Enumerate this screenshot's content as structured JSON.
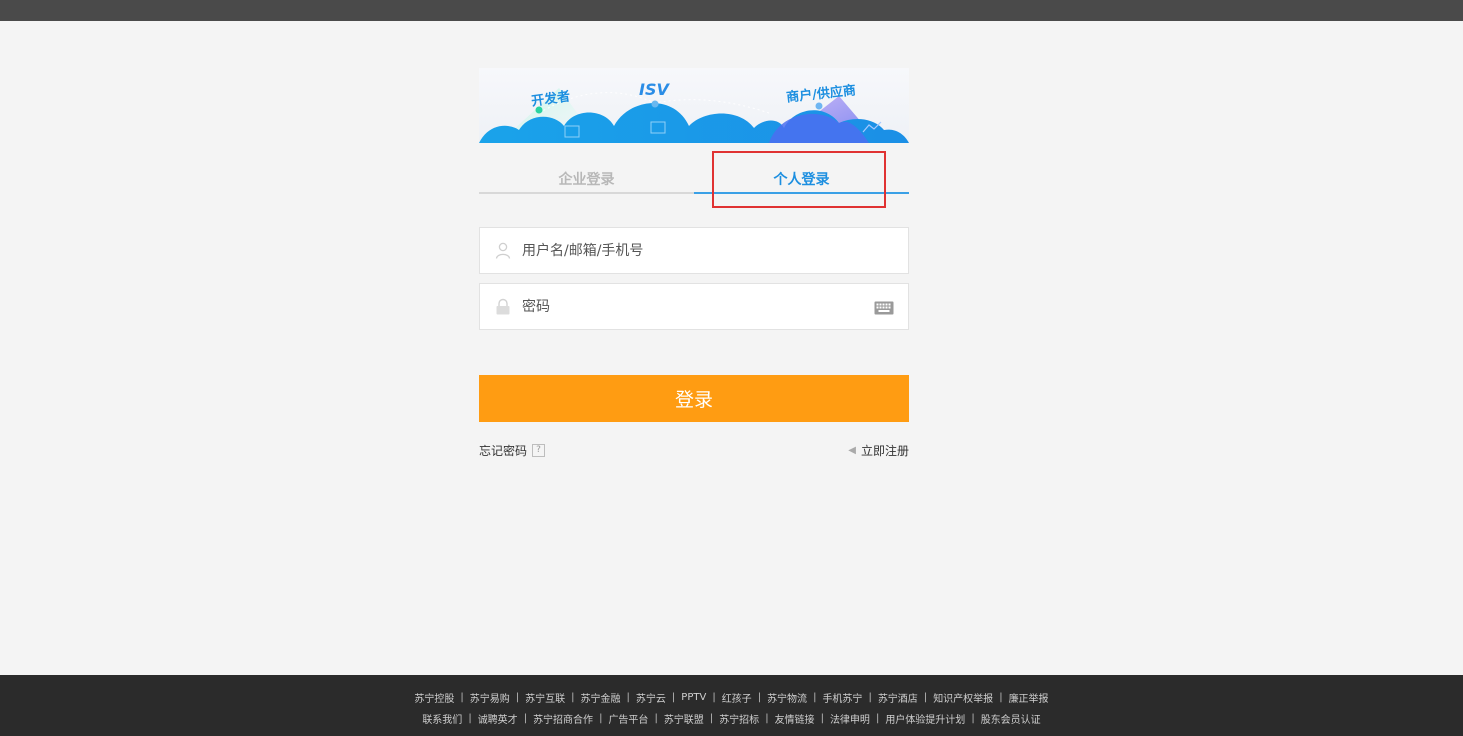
{
  "banner": {
    "developer": "开发者",
    "isv": "ISV",
    "merchant": "商户/供应商"
  },
  "tabs": [
    {
      "label": "企业登录",
      "active": false
    },
    {
      "label": "个人登录",
      "active": true
    }
  ],
  "form": {
    "username_placeholder": "用户名/邮箱/手机号",
    "password_placeholder": "密码",
    "login_label": "登录",
    "forgot_label": "忘记密码",
    "help_glyph": "?",
    "register_label": "立即注册"
  },
  "footer": {
    "row1": [
      "苏宁控股",
      "苏宁易购",
      "苏宁互联",
      "苏宁金融",
      "苏宁云",
      "PPTV",
      "红孩子",
      "苏宁物流",
      "手机苏宁",
      "苏宁酒店",
      "知识产权举报",
      "廉正举报"
    ],
    "row2": [
      "联系我们",
      "诚聘英才",
      "苏宁招商合作",
      "广告平台",
      "苏宁联盟",
      "苏宁招标",
      "友情链接",
      "法律申明",
      "用户体验提升计划",
      "股东会员认证"
    ]
  },
  "colors": {
    "accent_blue": "#1d8fe0",
    "login_orange": "#ff9c12",
    "highlight_red": "#e03232"
  }
}
